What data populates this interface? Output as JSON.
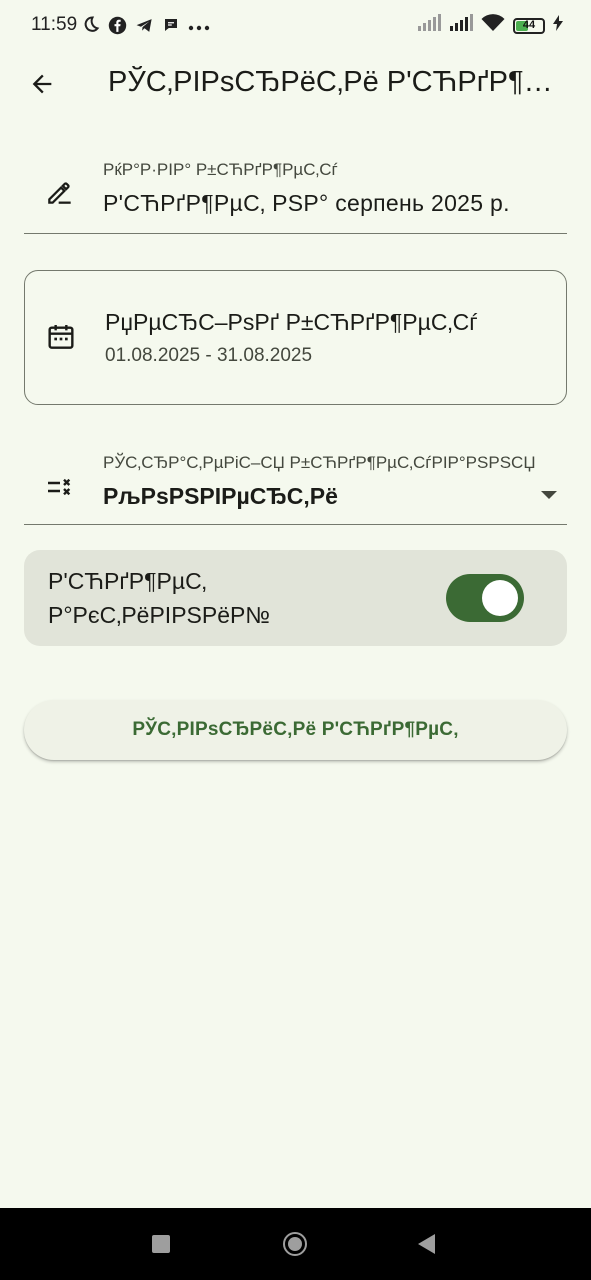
{
  "status_bar": {
    "time": "11:59",
    "battery_level": "44",
    "icons": [
      "moon-icon",
      "facebook-icon",
      "telegram-icon",
      "chat-icon",
      "more-icon",
      "signal-icon",
      "signal-icon",
      "wifi-icon",
      "battery-icon",
      "charging-icon"
    ]
  },
  "app_bar": {
    "title": "РЎС‚РІРѕСЂРёС‚Рё Р'СЋРґР¶РµС‚"
  },
  "name_field": {
    "label": "РќР°Р·РІР° Р±СЋРґР¶РµС‚Сѓ",
    "value": "Р'СЋРґР¶РµС‚ РЅР° серпень 2025 р."
  },
  "period_card": {
    "title": "РџРµСЂС–РѕРґ Р±СЋРґР¶РµС‚Сѓ",
    "range": "01.08.2025 - 31.08.2025"
  },
  "filter_field": {
    "label": "РЎС‚СЂР°С‚РµРіС–СЏ Р±СЋРґР¶РµС‚СѓРІР°РЅРЅСЏ",
    "value": "РљРѕРЅРІРµСЂС‚Рё"
  },
  "toggle_row": {
    "label": "Р'СЋРґР¶РµС‚ Р°РєС‚РёРІРЅРёР№",
    "checked": true
  },
  "export_button": {
    "label": "РЎС‚РІРѕСЂРёС‚Рё Р'СЋРґР¶РµС‚"
  },
  "colors": {
    "background": "#f5f9ee",
    "accent": "#3b6a34",
    "toggle_row_bg": "#e1e4d9",
    "outline": "#74796d"
  }
}
